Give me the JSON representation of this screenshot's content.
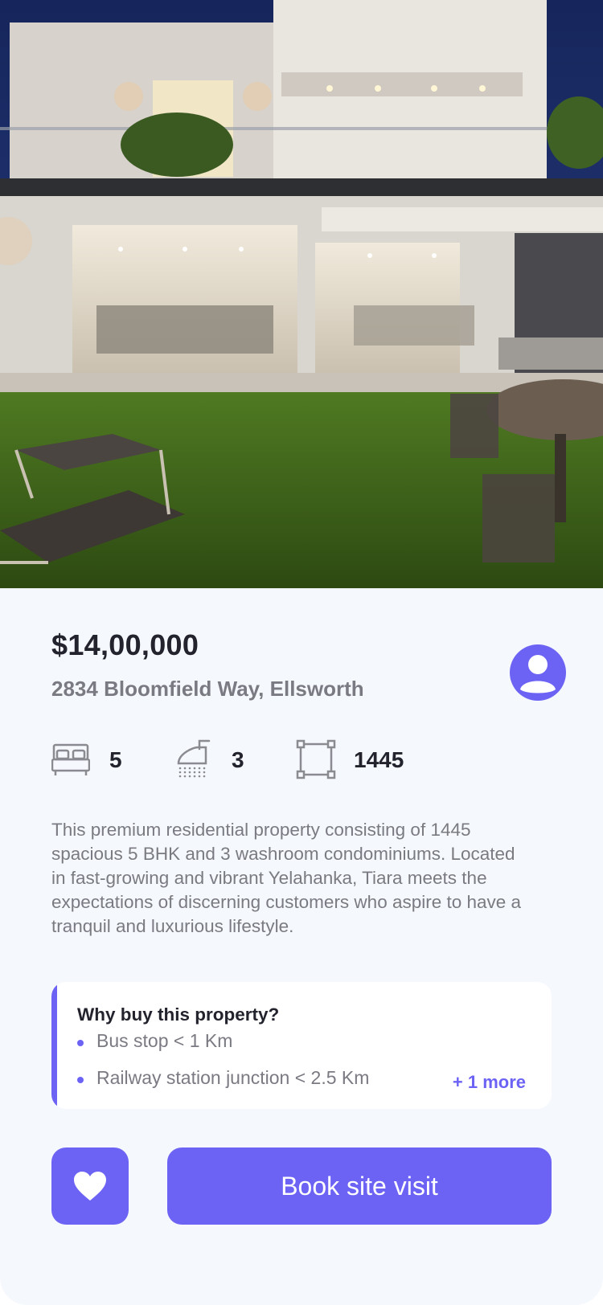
{
  "listing": {
    "price": "$14,00,000",
    "address": "2834 Bloomfield Way, Ellsworth",
    "stats": {
      "bedrooms": "5",
      "bathrooms": "3",
      "area": "1445"
    },
    "description": "This premium residential property consisting of 1445 spacious 5 BHK and 3 washroom condominiums. Located in fast-growing and vibrant Yelahanka, Tiara meets the expectations of discerning customers who aspire to have a tranquil and luxurious lifestyle."
  },
  "why_buy": {
    "title": "Why buy this property?",
    "items": [
      "Bus stop < 1 Km",
      "Railway station junction < 2.5 Km"
    ],
    "more_label": "+ 1 more"
  },
  "actions": {
    "book_label": "Book site visit"
  },
  "icons": {
    "bedrooms": "bed-icon",
    "bathrooms": "shower-icon",
    "area": "area-icon",
    "agent": "user-icon",
    "favorite": "heart-icon"
  },
  "colors": {
    "accent": "#6c63f5",
    "background": "#f5f8fd",
    "text_primary": "#22232d",
    "text_secondary": "#7a7a83"
  }
}
